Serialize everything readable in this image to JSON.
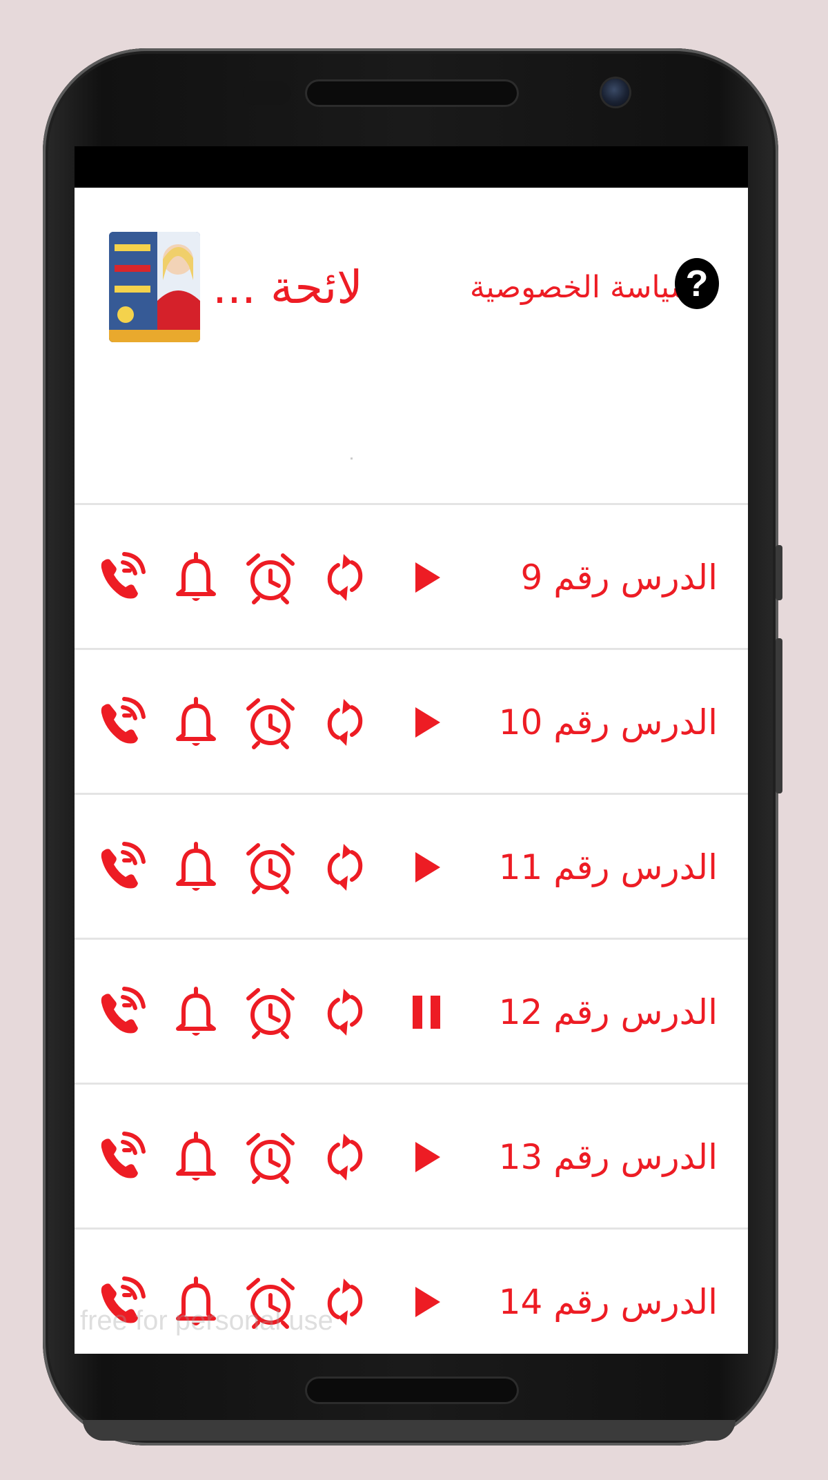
{
  "app": {
    "title": "لائحة ...",
    "privacy_label": "سياسة الخصوصية",
    "help_symbol": "?",
    "logo_icon": "app-logo-icon",
    "accent_color": "#ed1c24"
  },
  "lessons": [
    {
      "label": "الدرس رقم 9",
      "state": "play"
    },
    {
      "label": "الدرس رقم 10",
      "state": "play"
    },
    {
      "label": "الدرس رقم 11",
      "state": "play"
    },
    {
      "label": "الدرس رقم 12",
      "state": "pause"
    },
    {
      "label": "الدرس رقم 13",
      "state": "play"
    },
    {
      "label": "الدرس رقم 14",
      "state": "play"
    }
  ],
  "row_icons": [
    "ringtone-call-icon",
    "notification-bell-icon",
    "alarm-clock-icon",
    "repeat-icon",
    "play-icon"
  ],
  "watermark": "free for personal use"
}
